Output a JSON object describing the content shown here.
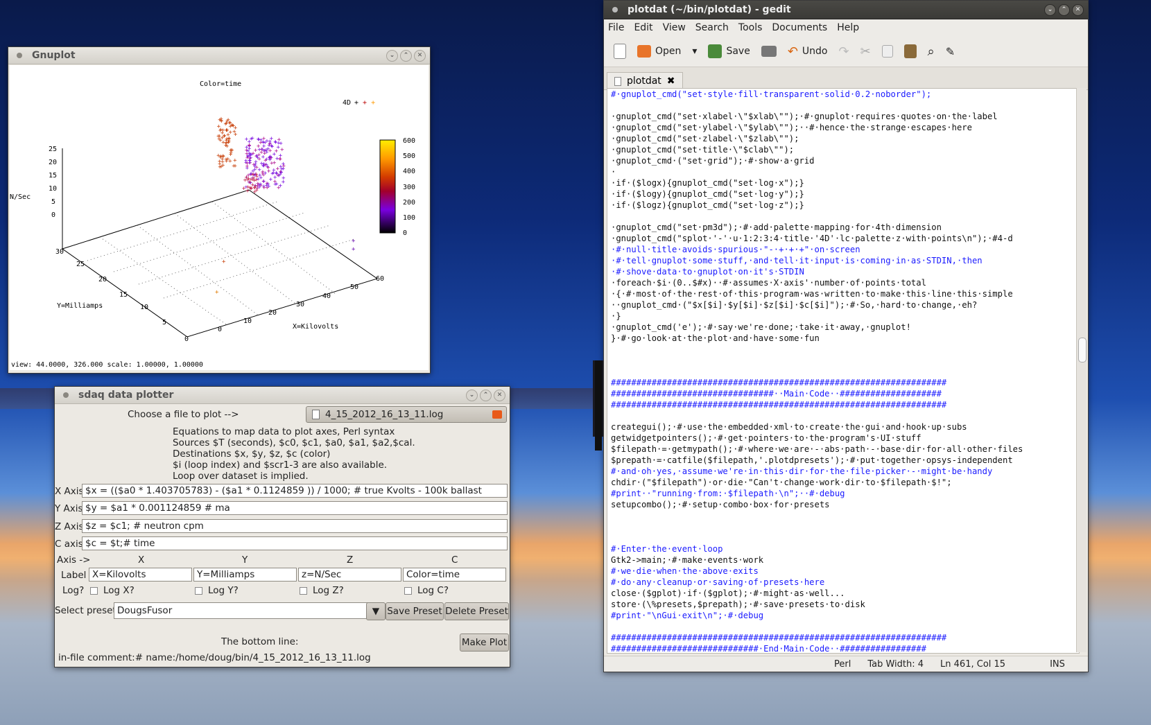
{
  "gnuplot": {
    "title": "Gnuplot",
    "plot_title": "Color=time",
    "legend": "4D",
    "xlabel": "X=Kilovolts",
    "ylabel": "Y=Milliamps",
    "zlabel": "N/Sec",
    "status": "view: 44.0000, 326.000 scale: 1.00000, 1.00000",
    "palette_ticks": [
      "600",
      "500",
      "400",
      "300",
      "200",
      "100",
      "0"
    ],
    "z_ticks": [
      "25",
      "20",
      "15",
      "10",
      "5",
      "0"
    ],
    "x_ticks": [
      "0",
      "10",
      "20",
      "30",
      "40",
      "50",
      "60"
    ],
    "y_ticks": [
      "30",
      "25",
      "20",
      "15",
      "10",
      "5",
      "0"
    ],
    "palette_colors": [
      "#ffee00",
      "#ff9a00",
      "#e24a00",
      "#b20000",
      "#6a00c8",
      "#3a0080",
      "#000000"
    ]
  },
  "sdaq": {
    "title": "sdaq data plotter",
    "choose_label": "Choose a file to plot -->",
    "file_name": "4_15_2012_16_13_11.log",
    "help_lines": [
      "Equations to map data to plot axes, Perl syntax",
      "Sources $T (seconds), $c0, $c1, $a0, $a1, $a2,$cal.",
      "Destinations $x, $y, $z, $c (color)",
      "$i (loop index) and $scr1-3 are also available.",
      "Loop over dataset is implied."
    ],
    "axes": [
      {
        "label": "X Axis",
        "value": "$x = (($a0 * 1.403705783) - ($a1 * 0.1124859 )) / 1000; # true Kvolts - 100k ballast"
      },
      {
        "label": "Y Axis",
        "value": "$y = $a1 * 0.001124859 # ma"
      },
      {
        "label": "Z Axis",
        "value": "$z = $c1; # neutron cpm"
      },
      {
        "label": "C axis",
        "value": "$c = $t;# time"
      }
    ],
    "axis_header": "Axis ->",
    "axis_cols": [
      "X",
      "Y",
      "Z",
      "C"
    ],
    "label_row": "Label",
    "labels": [
      "X=Kilovolts",
      "Y=Milliamps",
      "z=N/Sec",
      "Color=time"
    ],
    "log_row": "Log?",
    "logs": [
      "Log X?",
      "Log Y?",
      "Log Z?",
      "Log C?"
    ],
    "preset_label": "Select preset:",
    "preset_value": "DougsFusor",
    "save_preset": "Save Preset",
    "delete_preset": "Delete Preset",
    "bottom_line": "The bottom line:",
    "make_plot": "Make Plot",
    "comment": "in-file comment:# name:/home/doug/bin/4_15_2012_16_13_11.log"
  },
  "gedit": {
    "title": "plotdat (~/bin/plotdat) - gedit",
    "menu": [
      "File",
      "Edit",
      "View",
      "Search",
      "Tools",
      "Documents",
      "Help"
    ],
    "open": "Open",
    "save": "Save",
    "undo": "Undo",
    "tab": "plotdat",
    "status": {
      "lang": "Perl",
      "tab_width": "Tab Width: 4",
      "position": "Ln 461, Col 15",
      "mode": "INS"
    }
  },
  "code": [
    "#·gnuplot_cmd(\"set·style·fill·transparent·solid·0.2·noborder\");",
    "",
    "·gnuplot_cmd(\"set·xlabel·\\\"$xlab\\\"\");·#·gnuplot·requires·quotes·on·the·label",
    "·gnuplot_cmd(\"set·ylabel·\\\"$ylab\\\"\");··#·hence·the·strange·escapes·here",
    "·gnuplot_cmd(\"set·zlabel·\\\"$zlab\\\"\");",
    "·gnuplot_cmd(\"set·title·\\\"$clab\\\"\");",
    "·gnuplot_cmd·(\"set·grid\");·#·show·a·grid",
    "·",
    "·if·($logx){gnuplot_cmd(\"set·log·x\");}",
    "·if·($logy){gnuplot_cmd(\"set·log·y\");}",
    "·if·($logz){gnuplot_cmd(\"set·log·z\");}",
    "",
    "·gnuplot_cmd(\"set·pm3d\");·#·add·palette·mapping·for·4th·dimension",
    "·gnuplot_cmd(\"splot·'-'·u·1:2:3:4·title·'4D'·lc·palette·z·with·points\\n\");·#4-d",
    "·#·null·title·avoids·spurious·\"-·+·+·+\"·on·screen",
    "·#·tell·gnuplot·some·stuff,·and·tell·it·input·is·coming·in·as·STDIN,·then",
    "·#·shove·data·to·gnuplot·on·it's·STDIN",
    "·foreach·$i·(0..$#x)··#·assumes·X·axis'·number·of·points·total",
    "·{·#·most·of·the·rest·of·this·program·was·written·to·make·this·line·this·simple",
    "··gnuplot_cmd·(\"$x[$i]·$y[$i]·$z[$i]·$c[$i]\");·#·So,·hard·to·change,·eh?",
    "·}",
    "·gnuplot_cmd('e');·#·say·we're·done;·take·it·away,·gnuplot!",
    "}·#·go·look·at·the·plot·and·have·some·fun",
    "",
    "",
    "",
    "##################################################################",
    "################################··Main·Code··####################",
    "##################################################################",
    "",
    "creategui();·#·use·the·embedded·xml·to·create·the·gui·and·hook·up·subs",
    "getwidgetpointers();·#·get·pointers·to·the·program's·UI·stuff",
    "$filepath·=·getmypath();·#·where·we·are·-·abs·path·-·base·dir·for·all·other·files",
    "$prepath·=·catfile($filepath,'.plotdpresets');·#·put·together·opsys-independent",
    "#·and·oh·yes,·assume·we're·in·this·dir·for·the·file·picker·-·might·be·handy",
    "chdir·(\"$filepath\")·or·die·\"Can't·change·work·dir·to·$filepath·$!\";",
    "#print··\"running·from:·$filepath·\\n\";··#·debug",
    "setupcombo();·#·setup·combo·box·for·presets",
    "",
    "",
    "",
    "#·Enter·the·event·loop",
    "Gtk2->main;·#·make·events·work",
    "#·we·die·when·the·above·exits",
    "#·do·any·cleanup·or·saving·of·presets·here",
    "close·($gplot)·if·($gplot);·#·might·as·well...",
    "store·(\\%presets,$prepath);·#·save·presets·to·disk",
    "#print·\"\\nGui·exit\\n\";·#·debug",
    "",
    "##################################################################",
    "#############################·End·Main·Code··#################",
    "##################################################################"
  ],
  "colors": {
    "comment": "#1a1aff",
    "string": "#c000c0",
    "keyword": "#a52a2a",
    "var": "#008b8b"
  }
}
